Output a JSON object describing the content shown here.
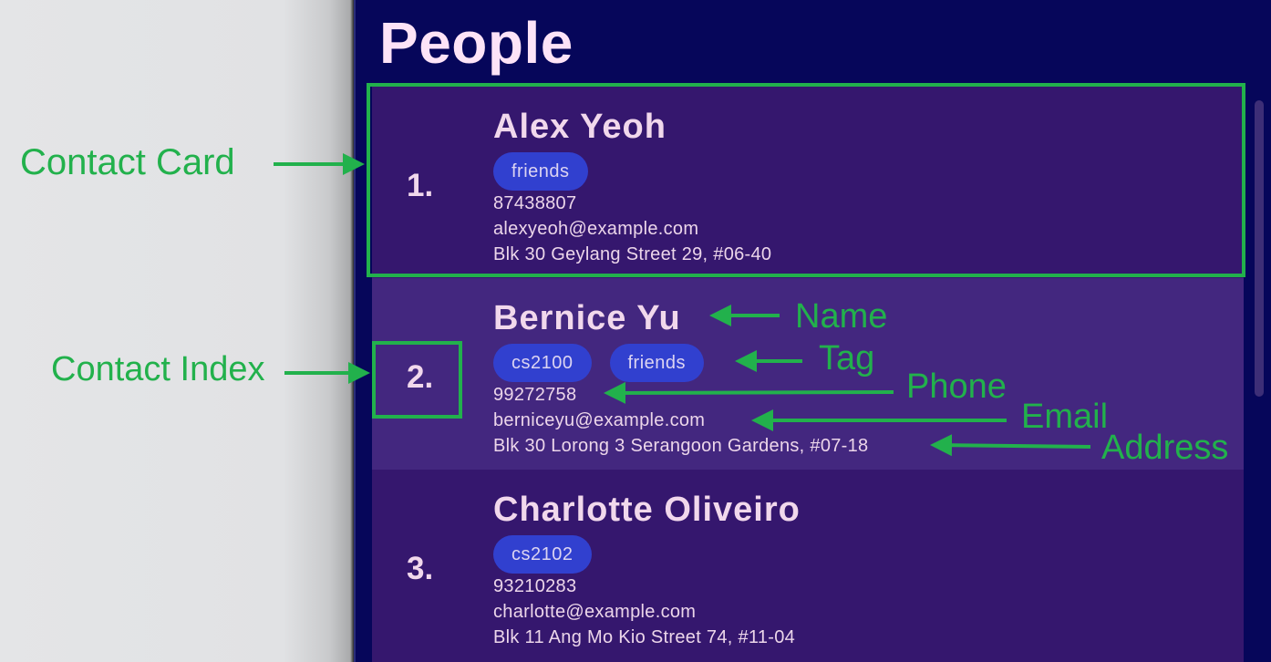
{
  "panel": {
    "title": "People"
  },
  "contacts": [
    {
      "index": "1.",
      "name": "Alex Yeoh",
      "tags": [
        "friends"
      ],
      "phone": "87438807",
      "email": "alexyeoh@example.com",
      "address": "Blk 30 Geylang Street 29, #06-40"
    },
    {
      "index": "2.",
      "name": "Bernice Yu",
      "tags": [
        "cs2100",
        "friends"
      ],
      "phone": "99272758",
      "email": "berniceyu@example.com",
      "address": "Blk 30 Lorong 3 Serangoon Gardens, #07-18"
    },
    {
      "index": "3.",
      "name": "Charlotte Oliveiro",
      "tags": [
        "cs2102"
      ],
      "phone": "93210283",
      "email": "charlotte@example.com",
      "address": "Blk 11 Ang Mo Kio Street 74, #11-04"
    }
  ],
  "annotations": {
    "contact_card": "Contact Card",
    "contact_index": "Contact Index",
    "name": "Name",
    "tag": "Tag",
    "phone": "Phone",
    "email": "Email",
    "address": "Address"
  },
  "colors": {
    "background": "#06065a",
    "card": "#35176e",
    "card_alt": "#43277f",
    "tag": "#3140cf",
    "text": "#f1d8ec",
    "annotation": "#22b14c"
  }
}
